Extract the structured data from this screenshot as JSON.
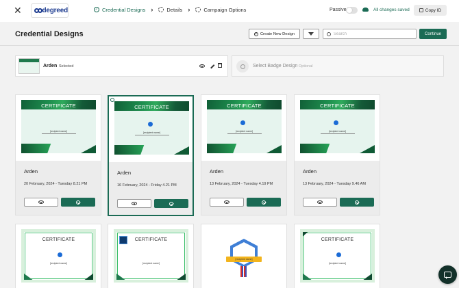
{
  "topbar": {
    "brand": "degreed",
    "steps": [
      {
        "label": "Credential Designs",
        "active": true
      },
      {
        "label": "Details",
        "active": false
      },
      {
        "label": "Campaign Options",
        "active": false
      }
    ],
    "passive_label": "Passive",
    "passive_on": false,
    "save_status": "All changes saved",
    "copy_id_label": "Copy ID"
  },
  "header": {
    "title": "Credential Designs",
    "create_label": "Create New Design",
    "search_placeholder": "Search",
    "continue_label": "Continue"
  },
  "selection": {
    "name": "Arden",
    "status": "Selected",
    "badge_label": "Select Badge Design",
    "badge_optional": "Optional"
  },
  "designs": [
    {
      "name": "Arden",
      "date": "20 February, 2024 - Tuesday 8.21 PM",
      "cert_title": "CERTIFICATE",
      "recipient": "[recipient name]"
    },
    {
      "name": "Arden",
      "date": "16 February, 2024 - Friday 4.21 PM",
      "cert_title": "CERTIFICATE",
      "recipient": "[recipient name]",
      "selected": true
    },
    {
      "name": "Arden",
      "date": "13 February, 2024 - Tuesday 4.19 PM",
      "cert_title": "CERTIFICATE",
      "recipient": "[recipient name]"
    },
    {
      "name": "Arden",
      "date": "13 February, 2024 - Tuesday 9.46 AM",
      "cert_title": "CERTIFICATE",
      "recipient": "[recipient name]"
    },
    {
      "cert_title": "CERTIFICATE",
      "recipient": "[recipient name]"
    },
    {
      "cert_title": "CERTIFICATE",
      "recipient": "[recipient name]"
    },
    {
      "badge_org": "Acme",
      "recipient": "[recipient name]"
    },
    {
      "cert_title": "CERTIFICATE",
      "recipient": "[recipient name]"
    }
  ],
  "colors": {
    "accent": "#1b6b55",
    "chat_button": "#13312a"
  },
  "icons": [
    "close-icon",
    "check-circle-icon",
    "gear-icon",
    "chevron-right-icon",
    "cloud-icon",
    "copy-icon",
    "plus-circle-icon",
    "filter-icon",
    "search-icon",
    "eye-icon",
    "pencil-icon",
    "trash-icon",
    "chat-icon"
  ]
}
